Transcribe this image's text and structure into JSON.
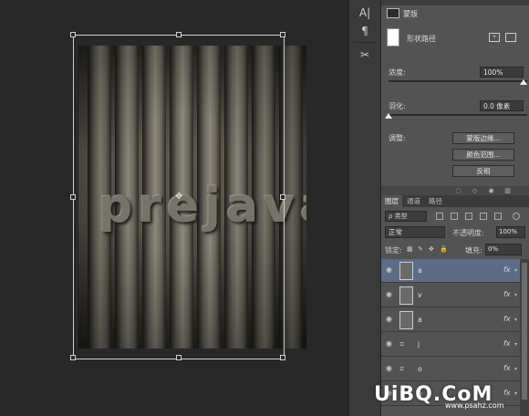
{
  "canvas": {
    "artwork_text": "prejava"
  },
  "properties": {
    "mask_title": "蒙版",
    "shape_label": "形状路径",
    "density_label": "浓度:",
    "density_value": "100%",
    "density_fraction": 1.0,
    "feather_label": "羽化:",
    "feather_value": "0.0 像素",
    "feather_fraction": 0.0,
    "adjust_label": "调整:",
    "buttons": [
      "蒙版边缘...",
      "颜色范围...",
      "反相"
    ]
  },
  "layers": {
    "tabs": [
      "图层",
      "通道",
      "路径"
    ],
    "filter_label": "ρ 类型",
    "blend_mode": "正常",
    "opacity_label": "不透明度:",
    "opacity_value": "100%",
    "lock_label": "锁定:",
    "fill_label": "填充:",
    "fill_value": "0%",
    "items": [
      {
        "name": "a",
        "thumb": "mask",
        "fx": "fx",
        "selected": true
      },
      {
        "name": "v",
        "thumb": "mask",
        "fx": "fx",
        "selected": false
      },
      {
        "name": "a",
        "thumb": "mask",
        "fx": "fx",
        "selected": false
      },
      {
        "name": "j",
        "thumb": "shape",
        "fx": "fx",
        "selected": false
      },
      {
        "name": "o",
        "thumb": "shape",
        "fx": "fx",
        "selected": false
      },
      {
        "name": "p",
        "thumb": "shape",
        "fx": "fx",
        "selected": false
      }
    ]
  },
  "watermark": {
    "main": "UiBQ.CoM",
    "sub": "www.psahz.com"
  },
  "colors": {
    "selected_layer": "#5d6c86",
    "panel_bg": "#535353",
    "workspace_bg": "#282828"
  }
}
